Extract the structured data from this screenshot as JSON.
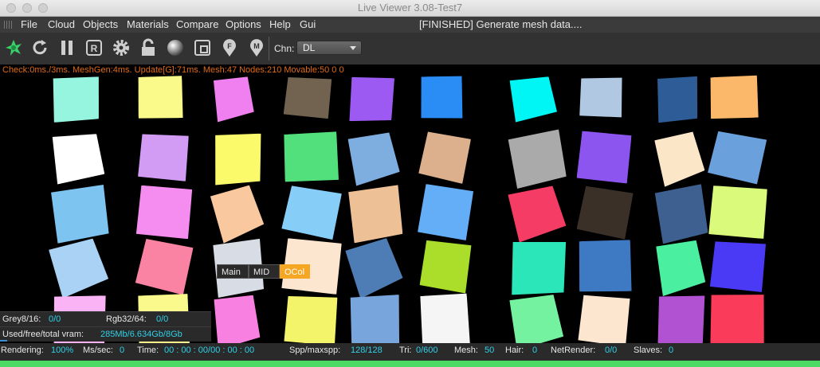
{
  "window": {
    "title": "Live Viewer 3.08-Test7"
  },
  "menu": {
    "items": [
      "File",
      "Cloud",
      "Objects",
      "Materials",
      "Compare",
      "Options",
      "Help",
      "Gui"
    ],
    "status_message": "[FINISHED] Generate mesh data...."
  },
  "toolbar": {
    "icons": [
      "octane-logo-icon",
      "restart-icon",
      "pause-icon",
      "render-region-icon",
      "settings-gear-icon",
      "lock-icon",
      "material-sphere-icon",
      "crop-icon",
      "focus-pin-icon",
      "material-pick-pin-icon"
    ],
    "channel_label": "Chn:",
    "channel_value": "DL"
  },
  "viewport": {
    "stats": "Check:0ms./3ms. MeshGen:4ms. Update[G]:71ms. Mesh:47 Nodes:210 Movable:50  0 0",
    "cube_colors": [
      "#96f5df",
      "#fafa8a",
      "#f080f0",
      "#726250",
      "#9d5af2",
      "#2a8cf5",
      "#00f5f5",
      "#b0c8e2",
      "#2e5c96",
      "#fcb86a",
      "#ffffff",
      "#d29cf5",
      "#fafa6a",
      "#52e07c",
      "#7eaee0",
      "#dcb08c",
      "#aaaaaa",
      "#8c55f0",
      "#fce6c8",
      "#6aa0dc",
      "#7ec4f0",
      "#f58cf0",
      "#fac89e",
      "#86cef8",
      "#eec096",
      "#64aef8",
      "#f43c64",
      "#3a3028",
      "#3e6090",
      "#dafa7c",
      "#aad2f5",
      "#fa82a2",
      "#d8dce4",
      "#fce6d0",
      "#4e7cb4",
      "#aade2a",
      "#2ae6b8",
      "#3e7ac4",
      "#4af0a0",
      "#4a3af5",
      "#fab4f5",
      "#fafa8c",
      "#f880e0",
      "#f4f46a",
      "#78a6dc",
      "#f5f5f5",
      "#74f2a0",
      "#fce6d0",
      "#b052d2",
      "#fa3c5a"
    ]
  },
  "info": {
    "grey_label": "Grey8/16:",
    "grey_value": "0/0",
    "rgb_label": "Rgb32/64:",
    "rgb_value": "0/0",
    "vram_label": "Used/free/total vram:",
    "vram_value": "285Mb/6.634Gb/8Gb",
    "vram_used_fraction": 0.035
  },
  "tabs": {
    "main": "Main",
    "mid": "MID",
    "ocol": "OCol"
  },
  "status": {
    "rendering_label": "Rendering:",
    "rendering_value": "100%",
    "ms_label": "Ms/sec:",
    "ms_value": "0",
    "time_label": "Time:",
    "time_value": "00 : 00 : 00/00 : 00 : 00",
    "spp_label": "Spp/maxspp:",
    "spp_value": "128/128",
    "tri_label": "Tri:",
    "tri_value": "0/600",
    "mesh_label": "Mesh:",
    "mesh_value": "50",
    "hair_label": "Hair:",
    "hair_value": "0",
    "net_label": "NetRender:",
    "net_value": "0/0",
    "slaves_label": "Slaves:",
    "slaves_value": "0",
    "progress": 1.0
  }
}
